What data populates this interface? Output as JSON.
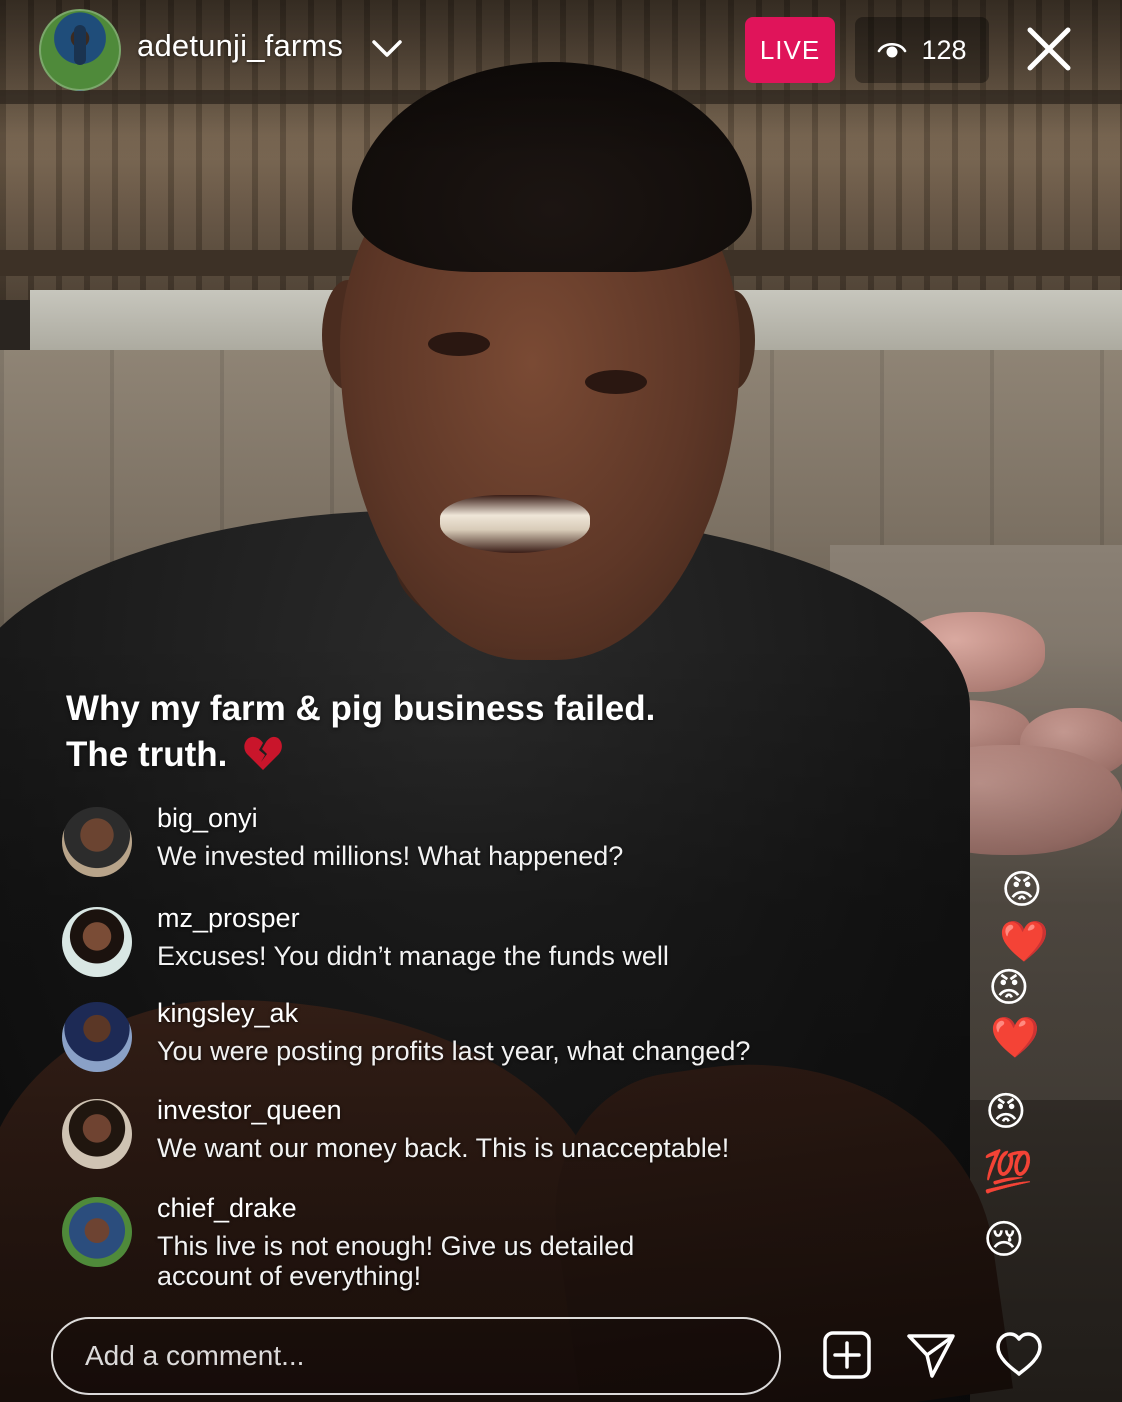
{
  "host": {
    "username": "adetunji_farms",
    "avatar_icon": "host-avatar"
  },
  "status": {
    "live_label": "LIVE",
    "live_color": "#e0145a",
    "viewer_count": "128"
  },
  "stream": {
    "title_line1": "Why my farm & pig business failed.",
    "title_line2": "The truth.",
    "title_emoji": "broken-heart"
  },
  "comments": [
    {
      "username": "big_onyi",
      "text": "We invested millions! What happened?"
    },
    {
      "username": "mz_prosper",
      "text": "Excuses! You didn’t manage the funds well"
    },
    {
      "username": "kingsley_ak",
      "text": "You were posting profits last year, what changed?"
    },
    {
      "username": "investor_queen",
      "text": "We want our money back. This is unacceptable!"
    },
    {
      "username": "chief_drake",
      "text": "This live is not enough! Give us detailed account of everything!"
    }
  ],
  "reactions": [
    "😡",
    "❤️",
    "😡",
    "❤️",
    "😡",
    "💯",
    "😢"
  ],
  "composer": {
    "placeholder": "Add a comment..."
  },
  "icons": {
    "close": "close-icon",
    "add": "add-square-icon",
    "share": "send-icon",
    "like": "heart-icon",
    "viewers": "eye-icon",
    "dropdown": "chevron-down-icon"
  }
}
